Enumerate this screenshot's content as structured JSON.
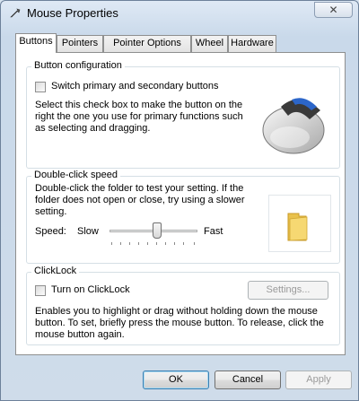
{
  "window": {
    "title": "Mouse Properties",
    "close_glyph": "✕",
    "title_icon": "mouse-pointer-icon"
  },
  "tabs": [
    {
      "label": "Buttons",
      "active": true
    },
    {
      "label": "Pointers",
      "active": false
    },
    {
      "label": "Pointer Options",
      "active": false
    },
    {
      "label": "Wheel",
      "active": false
    },
    {
      "label": "Hardware",
      "active": false
    }
  ],
  "button_configuration": {
    "group_title": "Button configuration",
    "checkbox_label": "Switch primary and secondary buttons",
    "checked": false,
    "description_lines": [
      "Select this check box to make the button on the",
      "right the one you use for primary functions such",
      "as selecting and dragging."
    ],
    "image_icon": "mouse-image-icon"
  },
  "double_click": {
    "group_title": "Double-click speed",
    "description_lines": [
      "Double-click the folder to test your setting. If the",
      "folder does not open or close, try using a slower",
      "setting."
    ],
    "speed_label": "Speed:",
    "slow_label": "Slow",
    "fast_label": "Fast",
    "slider_value": 0.55,
    "folder_icon": "folder-icon"
  },
  "clicklock": {
    "group_title": "ClickLock",
    "checkbox_label": "Turn on ClickLock",
    "checked": false,
    "settings_button": "Settings...",
    "description_lines": [
      "Enables you to highlight or drag without holding down the mouse",
      "button. To set, briefly press the mouse button. To release, click the",
      "mouse button again."
    ]
  },
  "footer": {
    "ok": "OK",
    "cancel": "Cancel",
    "apply": "Apply"
  },
  "colors": {
    "accent": "#3c7fb1",
    "disabled_text": "#9a9a9a",
    "folder": "#f2cf5b"
  }
}
